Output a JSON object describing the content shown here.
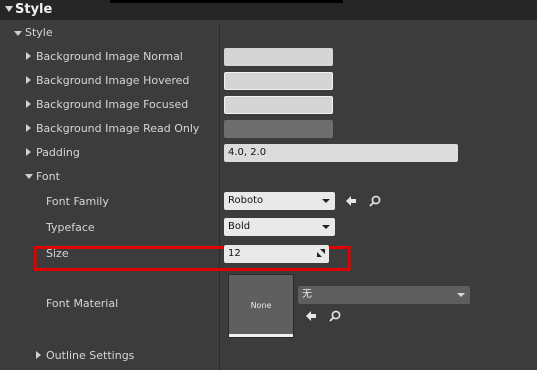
{
  "header": {
    "title": "Style"
  },
  "section": {
    "title": "Style"
  },
  "rows": {
    "bg_normal": "Background Image Normal",
    "bg_hovered": "Background Image Hovered",
    "bg_focused": "Background Image Focused",
    "bg_readonly": "Background Image Read Only",
    "padding": "Padding",
    "font": "Font",
    "font_family": "Font Family",
    "typeface": "Typeface",
    "size": "Size",
    "font_material": "Font Material",
    "outline_settings": "Outline Settings"
  },
  "values": {
    "padding": "4.0, 2.0",
    "font_family": "Roboto",
    "typeface": "Bold",
    "size": "12",
    "font_material_selected": "无",
    "thumbnail_label": "None"
  },
  "colors": {
    "highlight": "#e00000",
    "background": "#3c3c3c",
    "header": "#262626"
  }
}
